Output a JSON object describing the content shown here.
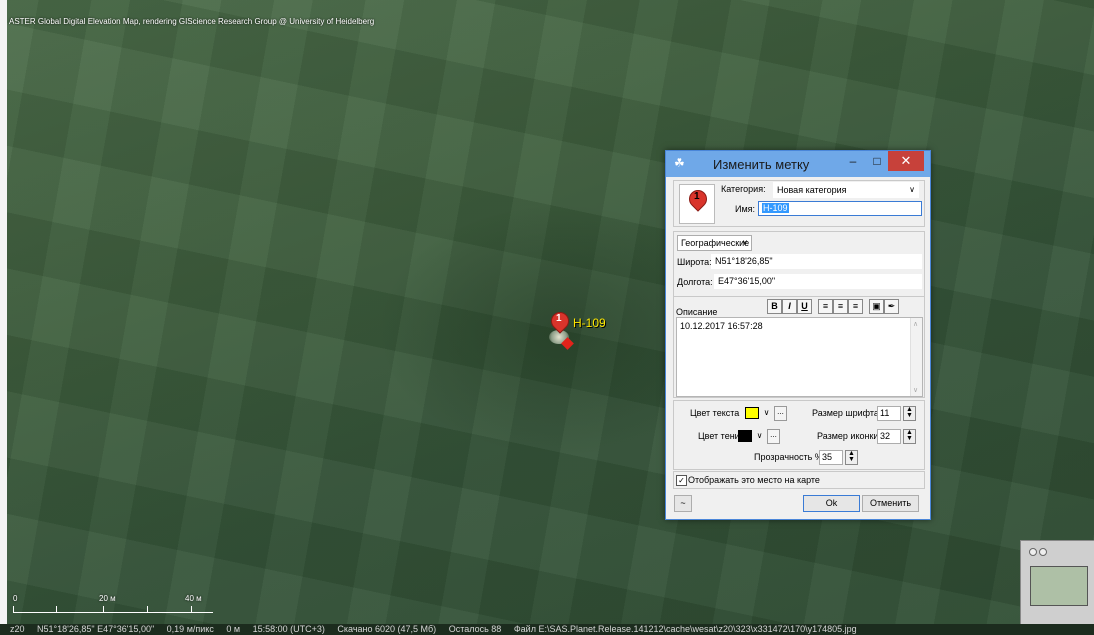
{
  "map": {
    "attribution": "ASTER Global Digital Elevation Map, rendering GIScience Research Group @ University of Heidelberg",
    "marker_number": "1",
    "marker_label": "H-109",
    "scale": {
      "labels": [
        "0",
        "20 м",
        "40 м"
      ]
    }
  },
  "statusbar": {
    "zoom": "z20",
    "coords": "N51°18'26,85\" E47°36'15,00\"",
    "resolution": "0,19 м/пикс",
    "elevation": "0 м",
    "time": "15:58:00 (UTC+3)",
    "downloaded": "Скачано 6020 (47,5 Мб)",
    "remaining": "Осталось 88",
    "file": "Файл E:\\SAS.Planet.Release.141212\\cache\\wesat\\z20\\323\\x331472\\170\\y174805.jpg"
  },
  "dialog": {
    "title": "Изменить метку",
    "icon_number": "1",
    "category_label": "Категория:",
    "category_value": "Новая категория",
    "name_label": "Имя:",
    "name_value": "H-109",
    "coord_format": "Географические",
    "lat_label": "Широта:",
    "lat_value": "N51°18'26,85\"",
    "lon_label": "Долгота:",
    "lon_value": "E47°36'15,00\"",
    "description_label": "Описание",
    "format_buttons": [
      "B",
      "I",
      "U"
    ],
    "description_text": "10.12.2017 16:57:28",
    "text_color_label": "Цвет текста",
    "text_color": "#ffff00",
    "font_size_label": "Размер шрифта",
    "font_size_value": "11",
    "shadow_color_label": "Цвет тени",
    "shadow_color": "#000000",
    "icon_size_label": "Размер иконки",
    "icon_size_value": "32",
    "opacity_label": "Прозрачность %",
    "opacity_value": "35",
    "show_on_map_label": "Отображать это место на карте",
    "show_on_map_checked": true,
    "extra_button": "~",
    "ok_label": "Ok",
    "cancel_label": "Отменить"
  },
  "colors": {
    "marker_label": "#ffe800",
    "titlebar": "#6fa8e8",
    "close_button": "#c7413a"
  }
}
